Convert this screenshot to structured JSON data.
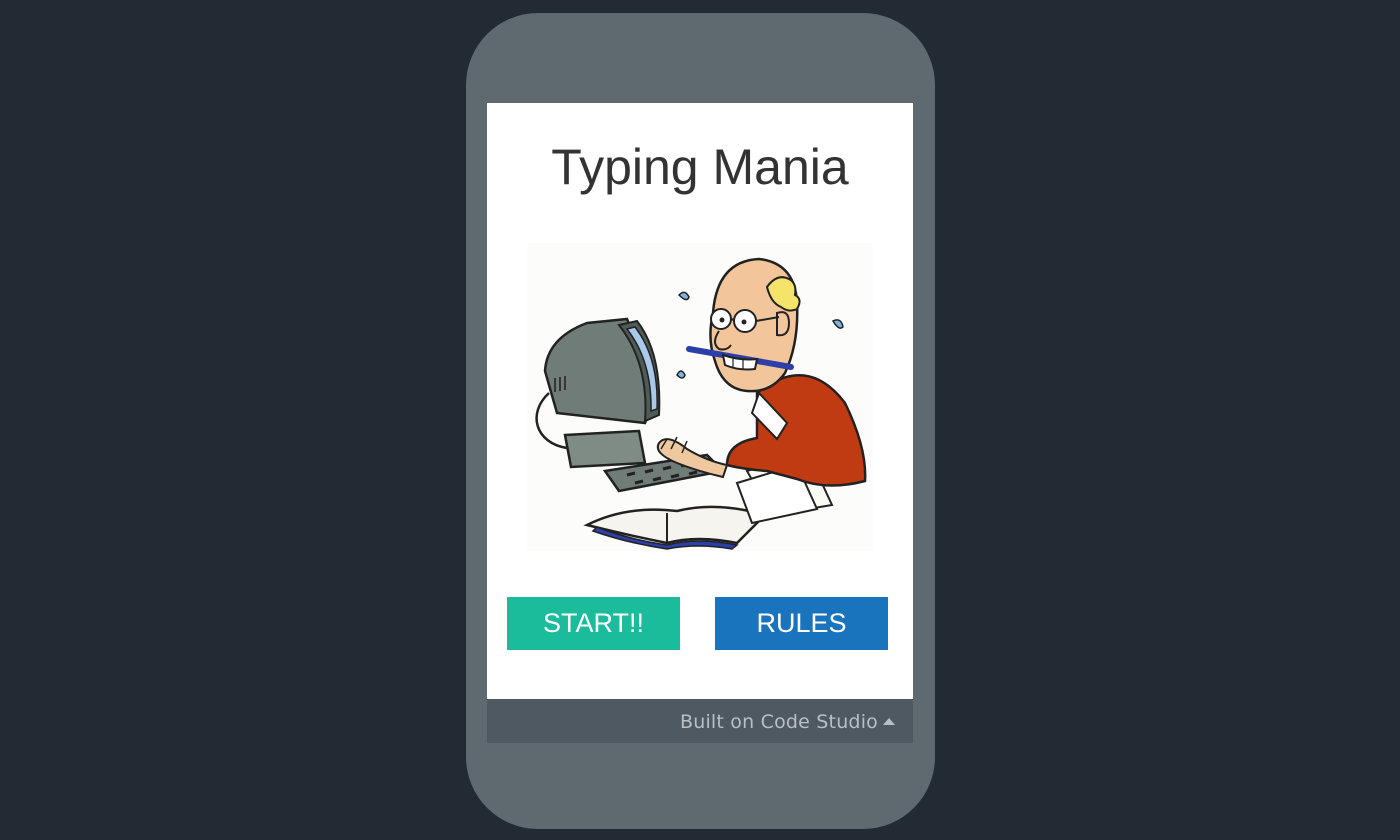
{
  "app": {
    "title": "Typing Mania"
  },
  "buttons": {
    "start_label": "START!!",
    "rules_label": "RULES"
  },
  "footer": {
    "link_label": "Built on Code Studio"
  },
  "illustration": {
    "name": "frantic-typist-illustration"
  },
  "colors": {
    "background": "#222a33",
    "phone_frame": "#5f6970",
    "start_button": "#1abc9c",
    "rules_button": "#1a73bd",
    "footer_bar": "#4f5961"
  }
}
